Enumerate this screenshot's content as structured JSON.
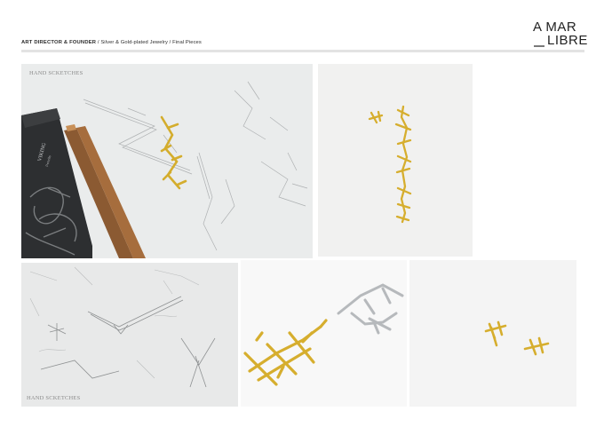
{
  "header": {
    "role": "ART DIRECTOR & FOUNDER",
    "separator": "/",
    "project": "Silver &  Gold-plated Jewelry",
    "separator2": "/",
    "section": "Final Pieces"
  },
  "logo": {
    "line1": "A MAR",
    "line2": "LIBRE"
  },
  "panels": {
    "sketch_top_caption": "HAND SCKETCHES",
    "sketch_bottom_caption": "HAND SCKETCHES",
    "pencil_box_brand": "VIKING",
    "pencil_box_sub": "Pencils"
  },
  "colors": {
    "gold": "#d9b533",
    "silver": "#b9bcc0",
    "sketch_bg": "#e9eaea",
    "rule": "#e3e3e3"
  }
}
